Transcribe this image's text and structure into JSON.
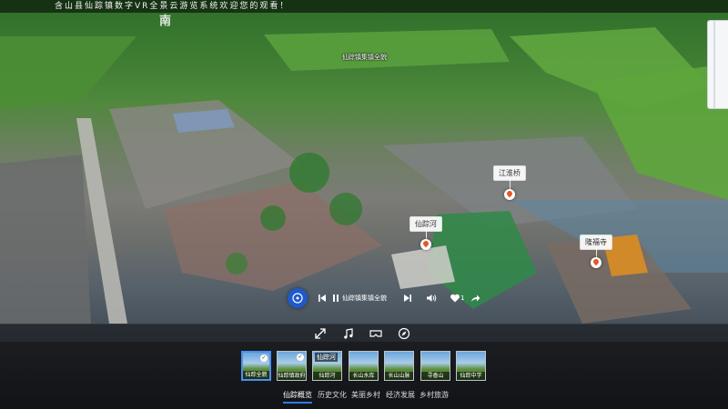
{
  "header": {
    "marquee": "含山县仙踪镇数字VR全景云游览系统欢迎您的观看！",
    "compass": "南"
  },
  "scene": {
    "map_labels": [
      "仙踪镇集镇全貌"
    ],
    "hotspots": [
      {
        "label": "江淮桥",
        "icon": "location-pin-icon"
      },
      {
        "label": "仙踪河",
        "icon": "location-pin-icon"
      },
      {
        "label": "隆福寺",
        "icon": "location-pin-icon"
      }
    ]
  },
  "player": {
    "track_title": "仙踪镇集镇全貌",
    "like_count": "1",
    "icons": [
      "music-disc-icon",
      "previous-icon",
      "pause-icon",
      "next-icon",
      "volume-icon",
      "heart-icon",
      "share-icon"
    ]
  },
  "toolbar": {
    "icons": [
      "gyroscope-icon",
      "music-note-icon",
      "vr-glasses-icon",
      "compass-icon"
    ]
  },
  "thumbnails": [
    {
      "caption": "仙踪全貌",
      "checked": true,
      "tag": ""
    },
    {
      "caption": "仙踪镇政府",
      "checked": true,
      "tag": ""
    },
    {
      "caption": "仙踪河",
      "checked": false,
      "tag": "仙踪河"
    },
    {
      "caption": "长山水库",
      "checked": false,
      "tag": ""
    },
    {
      "caption": "长山山脉",
      "checked": false,
      "tag": ""
    },
    {
      "caption": "寻香山",
      "checked": false,
      "tag": ""
    },
    {
      "caption": "仙踪中学",
      "checked": false,
      "tag": ""
    }
  ],
  "categories": [
    "仙踪概览",
    "历史文化",
    "美丽乡村",
    "经济发展",
    "乡村旅游"
  ],
  "colors": {
    "accent": "#2f7bf0",
    "pin": "#e25a27",
    "disc": "#1f59c9"
  }
}
